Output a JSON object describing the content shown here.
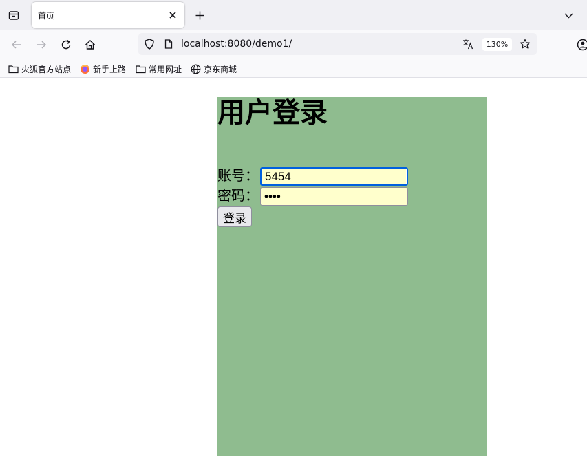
{
  "browser": {
    "tab": {
      "title": "首页"
    },
    "url": "localhost:8080/demo1/",
    "zoom": "130%",
    "bookmarks": [
      {
        "label": "火狐官方站点",
        "icon": "folder-icon"
      },
      {
        "label": "新手上路",
        "icon": "firefox-icon"
      },
      {
        "label": "常用网址",
        "icon": "folder-icon"
      },
      {
        "label": "京东商城",
        "icon": "globe-icon"
      }
    ]
  },
  "page": {
    "title": "用户登录",
    "account_label": "账号：",
    "account_value": "5454",
    "password_label": "密码：",
    "password_value": "1234",
    "login_button": "登录",
    "colors": {
      "box_background": "#8fbc8f",
      "input_background": "#ffffcc",
      "focus_ring": "#0060df"
    }
  }
}
